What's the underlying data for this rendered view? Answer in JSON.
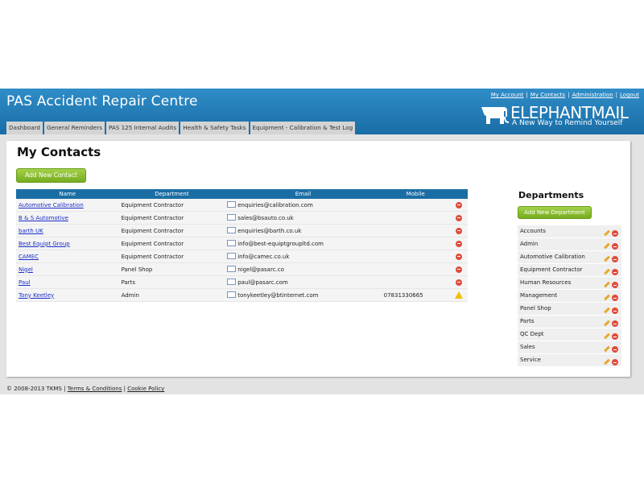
{
  "app": {
    "title": "PAS Accident Repair Centre"
  },
  "top_links": [
    "My Account",
    "My Contacts",
    "Administration",
    "Logout"
  ],
  "brand": {
    "name": "ELEPHANTMAIL",
    "tagline": "A New Way to Remind Yourself"
  },
  "tabs": [
    "Dashboard",
    "General Reminders",
    "PAS 125 Internal Audits",
    "Health & Safety Tasks",
    "Equipment - Calibration & Test Log"
  ],
  "page": {
    "title": "My Contacts",
    "add_contact_label": "Add New Contact"
  },
  "contacts": {
    "columns": [
      "Name",
      "Department",
      "Email",
      "Mobile"
    ],
    "rows": [
      {
        "name": "Automotive Calibration",
        "department": "Equipment Contractor",
        "email": "enquiries@calibration.com",
        "mobile": "",
        "action": "delete"
      },
      {
        "name": "B & S Automotive",
        "department": "Equipment Contractor",
        "email": "sales@bsauto.co.uk",
        "mobile": "",
        "action": "delete"
      },
      {
        "name": "barth UK",
        "department": "Equipment Contractor",
        "email": "enquiries@barth.co.uk",
        "mobile": "",
        "action": "delete"
      },
      {
        "name": "Best Equipt Group",
        "department": "Equipment Contractor",
        "email": "info@best-equiptgroupltd.com",
        "mobile": "",
        "action": "delete"
      },
      {
        "name": "CAMEC",
        "department": "Equipment Contractor",
        "email": "info@camec.co.uk",
        "mobile": "",
        "action": "delete"
      },
      {
        "name": "Nigel",
        "department": "Panel Shop",
        "email": "nigel@pasarc.co",
        "mobile": "",
        "action": "delete"
      },
      {
        "name": "Paul",
        "department": "Parts",
        "email": "paul@pasarc.com",
        "mobile": "",
        "action": "delete"
      },
      {
        "name": "Tony Keetley",
        "department": "Admin",
        "email": "tonykeetley@btinternet.com",
        "mobile": "07831330665",
        "action": "warning"
      }
    ]
  },
  "departments": {
    "title": "Departments",
    "add_label": "Add New Department",
    "items": [
      "Accounts",
      "Admin",
      "Automotive Calibration",
      "Equipment Contractor",
      "Human Resources",
      "Management",
      "Panel Shop",
      "Parts",
      "QC Dept",
      "Sales",
      "Service"
    ]
  },
  "footer": {
    "copyright": "© 2008-2013 TKMS",
    "links": [
      "Terms & Conditions",
      "Cookie Policy"
    ]
  },
  "colors": {
    "header": "#1f78b4",
    "accent_green": "#8cc036",
    "table_header": "#1a6ea4",
    "link": "#1a2ec8"
  }
}
